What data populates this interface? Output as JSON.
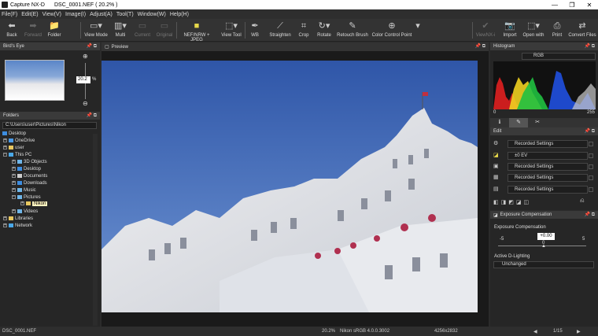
{
  "window": {
    "title": "Capture NX-D",
    "file": "DSC_0001.NEF ( 20.2% )",
    "min": "—",
    "restore": "❐",
    "close": "✕"
  },
  "menu": [
    "File(F)",
    "Edit(E)",
    "View(V)",
    "Image(I)",
    "Adjust(A)",
    "Tool(T)",
    "Window(W)",
    "Help(H)"
  ],
  "toolbar": {
    "back": "Back",
    "forward": "Forward",
    "folder": "Folder",
    "view_mode": "View Mode",
    "multi": "Multi",
    "current": "Current",
    "original": "Original",
    "nef": "NEF/NRW + JPEG",
    "view_tool": "View Tool",
    "wb": "WB",
    "straighten": "Straighten",
    "crop": "Crop",
    "rotate": "Rotate",
    "retouch": "Retouch Brush",
    "ccp": "Color Control Point",
    "viewnx": "ViewNX-i",
    "import": "Import",
    "open_with": "Open with",
    "print": "Print",
    "convert": "Convert Files"
  },
  "birds_eye": {
    "title": "Bird's Eye",
    "zoom": "20.2",
    "unit": "%"
  },
  "folders": {
    "title": "Folders",
    "path": "C:\\Users\\user\\Pictures\\Nikon",
    "items": [
      "Desktop",
      "OneDrive",
      "user",
      "This PC",
      "3D Objects",
      "Desktop",
      "Documents",
      "Downloads",
      "Music",
      "Pictures",
      "Nikon",
      "Videos",
      "Libraries",
      "Network"
    ]
  },
  "preview": {
    "title": "Preview"
  },
  "histogram": {
    "title": "Histogram",
    "channel": "RGB",
    "min": "0",
    "max": "255"
  },
  "edit": {
    "title": "Edit",
    "rows": [
      "Recorded Settings",
      "±0 EV",
      "Recorded Settings",
      "Recorded Settings",
      "Recorded Settings"
    ]
  },
  "exposure": {
    "title": "Exposure Compensation",
    "label": "Exposure Compensation",
    "value": "+0.00",
    "ticks": [
      "-5",
      "0",
      "5"
    ],
    "adl_label": "Active D-Lighting",
    "adl_value": "Unchanged"
  },
  "status": {
    "file": "DSC_0001.NEF",
    "zoom": "20.2%",
    "profile": "Nikon sRGB 4.0.0.3002",
    "size": "4256x2832",
    "page": "1/15"
  }
}
